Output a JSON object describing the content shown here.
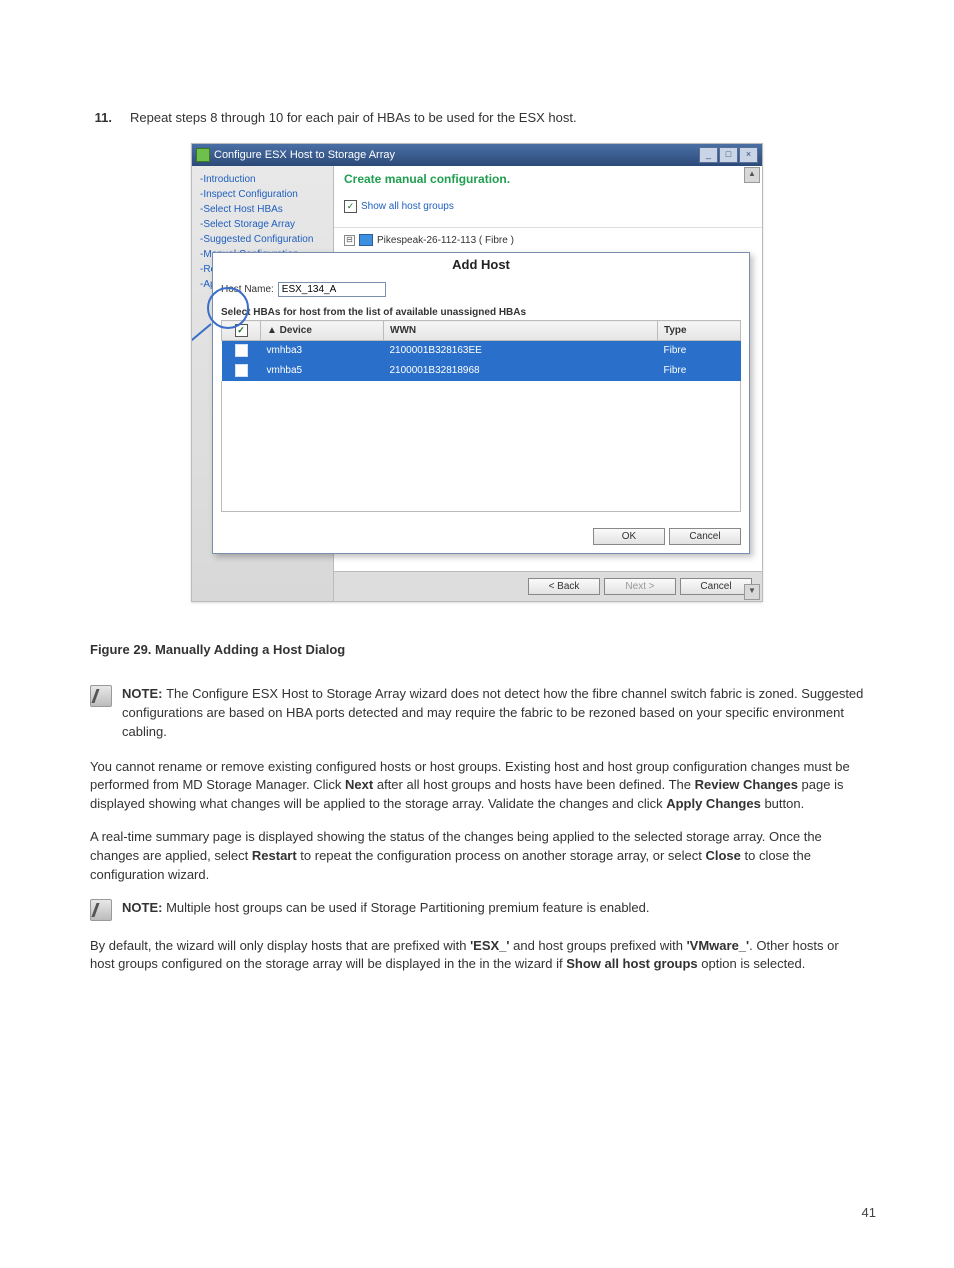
{
  "step": {
    "num": "11.",
    "text": "Repeat steps 8 through 10 for each pair of HBAs to be used for the ESX host."
  },
  "window": {
    "title": "Configure ESX Host to Storage Array",
    "min": "_",
    "max": "□",
    "close": "×",
    "nav": [
      "-Introduction",
      "-Inspect Configuration",
      "-Select Host HBAs",
      "-Select Storage Array",
      "-Suggested Configuration",
      "-Manual Configuration",
      "-Re",
      "-Ap"
    ],
    "header": "Create manual configuration.",
    "show_label": "Show all host groups",
    "show_checked": "✓",
    "tree_exp": "⊟",
    "tree_label": "Pikespeak-26-112-113 ( Fibre )",
    "footer": {
      "back": "< Back",
      "next": "Next >",
      "cancel": "Cancel"
    }
  },
  "dialog": {
    "title": "Add Host",
    "hostname_label": "Host Name:",
    "hostname_value": "ESX_134_A",
    "instr": "Select HBAs for host from the list of available unassigned HBAs",
    "th": {
      "chk": "✓",
      "device": "▲ Device",
      "wwn": "WWN",
      "type": "Type"
    },
    "rows": [
      {
        "chk": "✓",
        "device": "vmhba3",
        "wwn": "2100001B328163EE",
        "type": "Fibre"
      },
      {
        "chk": "✓",
        "device": "vmhba5",
        "wwn": "2100001B32818968",
        "type": "Fibre"
      }
    ],
    "ok": "OK",
    "cancel": "Cancel"
  },
  "caption": "Figure 29. Manually Adding a Host Dialog",
  "note1": {
    "lead": "NOTE: ",
    "body": "The Configure ESX Host to Storage Array wizard does not detect how the fibre channel switch fabric is zoned. Suggested configurations are based on HBA ports detected and may require the fabric to be rezoned based on your specific environment cabling."
  },
  "para1": {
    "a": "You cannot rename or remove existing configured hosts or host groups. Existing host and host group configuration changes must be performed from MD Storage Manager. Click ",
    "b": "Next",
    "c": " after all host groups and hosts have been defined. The ",
    "d": "Review Changes",
    "e": " page is displayed showing what changes will be applied to the storage array. Validate the changes and click ",
    "f": "Apply Changes",
    "g": " button."
  },
  "para2": {
    "a": "A real-time summary page is displayed showing the status of the changes being applied to the selected storage array. Once the changes are applied, select ",
    "b": "Restart",
    "c": " to repeat the configuration process on another storage array, or select ",
    "d": "Close",
    "e": " to close the configuration wizard."
  },
  "note2": {
    "lead": "NOTE: ",
    "body": "Multiple host groups can be used if Storage Partitioning premium feature is enabled."
  },
  "para3": {
    "a": "By default, the wizard will only display hosts that are prefixed with ",
    "b": "'ESX_'",
    "c": " and host groups prefixed with ",
    "d": "'VMware_'",
    "e": ". Other hosts or host groups configured on the storage array will be displayed in the in the wizard if ",
    "f": "Show all host groups",
    "g": " option is selected."
  },
  "page_num": "41"
}
